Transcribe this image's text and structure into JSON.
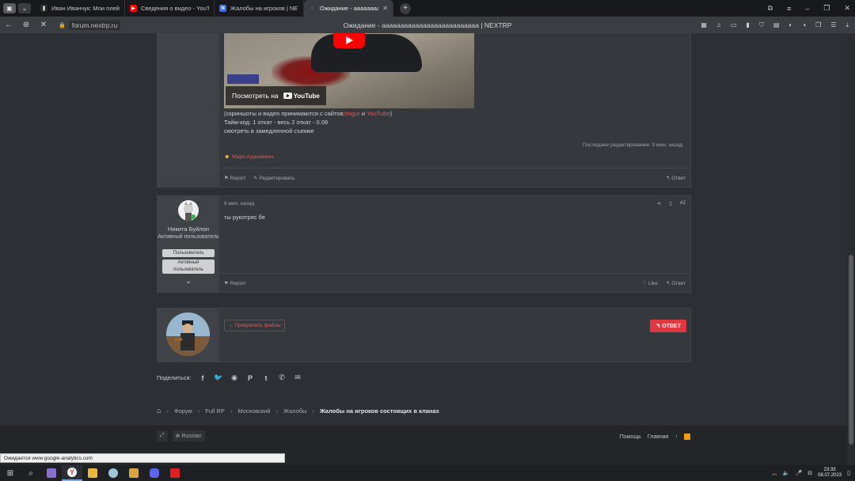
{
  "browser": {
    "tabs": [
      {
        "title": "Иван Иванчук: Мои плей",
        "fav_color": "#2c2c2c",
        "fav_glyph": "❚❚"
      },
      {
        "title": "Сведения о видео - YouT",
        "fav_color": "#ff0000",
        "fav_glyph": "▶"
      },
      {
        "title": "Жалобы на игроков | NE",
        "fav_color": "#3d6ee0",
        "fav_glyph": "N"
      },
      {
        "title": "Ожидание - аааааааа",
        "fav_color": "#555",
        "fav_glyph": "◌",
        "close": "✕"
      }
    ],
    "url": "forum.nextrp.ru",
    "page_title": "Ожидание - аааааааааааааааааааааааааа | NEXTRP"
  },
  "post1": {
    "video_watch_label": "Посмотреть на",
    "video_brand": "YouTube",
    "text_line1_pre": "(скриншоты и видео принимаются с сайтов:",
    "link_imgur": "Imgur",
    "text_and": "и",
    "link_youtube": "YouTube",
    "text_line1_post": ")",
    "text_line2": "Тайм-код: 1 откат - весь 2 откат - 0.08",
    "text_line3": "смотреть в замедленной съемке",
    "last_edited": "Последнее редактирование: 9 мин. назад",
    "reaction_user": "Мари Адашкевич",
    "report_label": "Report",
    "edit_label": "Редактировать",
    "reply_label": "Ответ"
  },
  "post2": {
    "time": "6 мин. назад",
    "post_number": "#2",
    "author_name": "Никита Буйлон",
    "author_title": "Активный пользователь",
    "badge1": "Пользователь",
    "badge2": "Активный пользователь",
    "content": "ты рукотряс бе",
    "report_label": "Report",
    "like_label": "Like",
    "reply_label": "Ответ"
  },
  "reply_box": {
    "attach_label": "Прикрепить файлы",
    "submit_label": "ОТВЕТ"
  },
  "share": {
    "label": "Поделиться:",
    "icons": [
      "facebook-icon",
      "twitter-icon",
      "reddit-icon",
      "pinterest-icon",
      "tumblr-icon",
      "whatsapp-icon",
      "email-icon"
    ]
  },
  "breadcrumbs": [
    "Форум",
    "Full RP",
    "Московский",
    "Жалобы",
    "Жалобы на игроков состоящих в кланах"
  ],
  "footer": {
    "language": "Russian",
    "help": "Помощь",
    "home": "Главная"
  },
  "status_bar": "Ожидается www.google-analytics.com",
  "taskbar": {
    "time": "23:33",
    "date": "08.07.2023"
  }
}
